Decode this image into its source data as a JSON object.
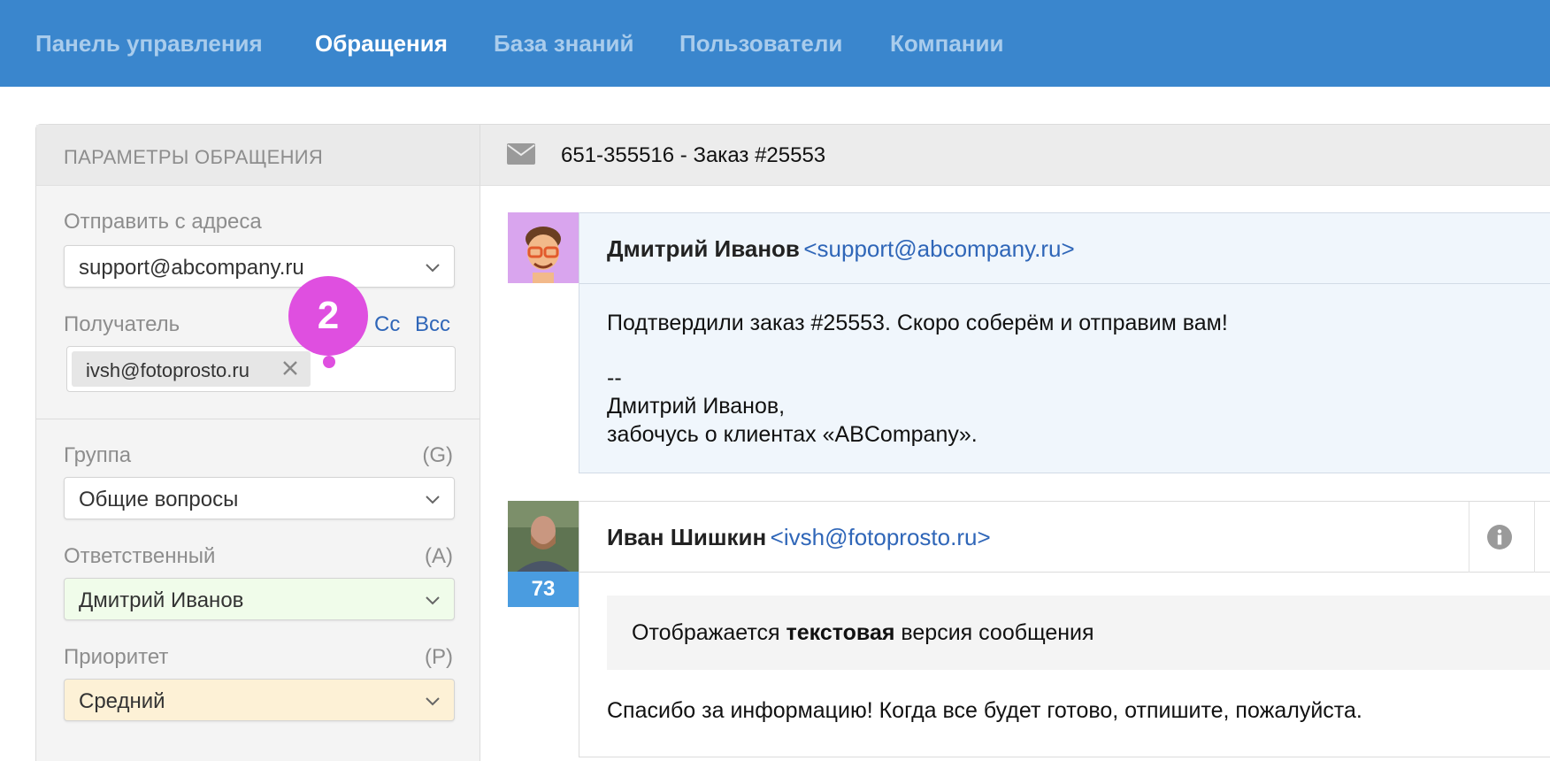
{
  "nav": {
    "items": [
      {
        "label": "Панель управления",
        "active": false
      },
      {
        "label": "Обращения",
        "active": true
      },
      {
        "label": "База знаний",
        "active": false
      },
      {
        "label": "Пользователи",
        "active": false
      },
      {
        "label": "Компании",
        "active": false
      }
    ]
  },
  "params": {
    "title": "ПАРАМЕТРЫ ОБРАЩЕНИЯ",
    "from_label": "Отправить с адреса",
    "from_value": "support@abcompany.ru",
    "recipient_label": "Получатель",
    "cc_label": "Cc",
    "bcc_label": "Bcc",
    "recipient_chip": "ivsh@fotoprosto.ru",
    "group_label": "Группа",
    "group_hint": "(G)",
    "group_value": "Общие вопросы",
    "assignee_label": "Ответственный",
    "assignee_hint": "(A)",
    "assignee_value": "Дмитрий Иванов",
    "priority_label": "Приоритет",
    "priority_hint": "(P)",
    "priority_value": "Средний"
  },
  "badge": {
    "number": "2",
    "color": "#df4fe0"
  },
  "ticket": {
    "subject": "651-355516 - Заказ #25553"
  },
  "messages": [
    {
      "name": "Дмитрий Иванов",
      "email": "<support@abcompany.ru>",
      "line1": "Подтвердили заказ #25553. Скоро соберём и отправим вам!",
      "sig_sep": "--",
      "sig_name": "Дмитрий Иванов,",
      "sig_text": "забочусь о клиентах «ABCompany»."
    },
    {
      "name": "Иван Шишкин",
      "email": "<ivsh@fotoprosto.ru>",
      "score": "73",
      "notice_pre": "Отображается ",
      "notice_bold": "текстовая",
      "notice_post": " версия сообщения",
      "body": "Спасибо за информацию! Когда все будет готово, отпишите, пожалуйста."
    }
  ],
  "colors": {
    "nav_bg": "#3a86cd",
    "link": "#2f66b8",
    "assignee_bg": "#f0fcea",
    "priority_bg": "#fdf1d6",
    "score_bg": "#4a9ce0"
  }
}
